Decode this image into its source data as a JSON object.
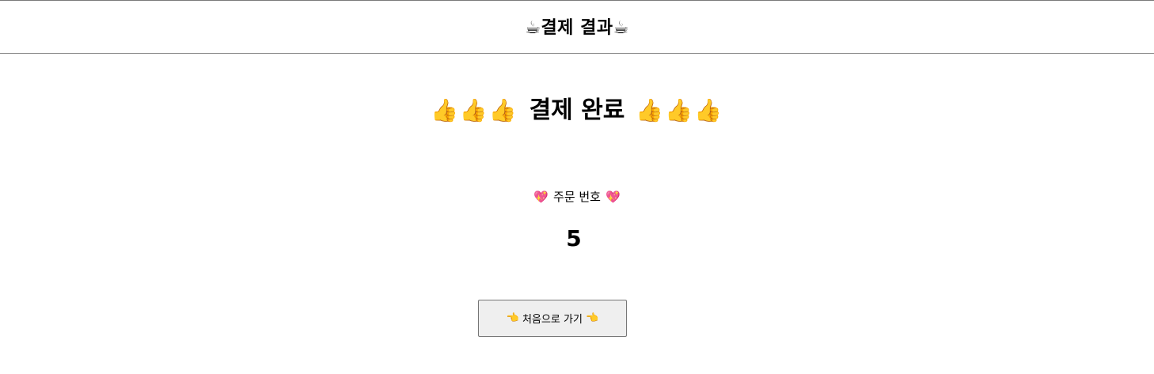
{
  "header": {
    "icon_left": "☕",
    "title": "결제 결과",
    "icon_right": "☕"
  },
  "complete": {
    "thumbs_left": "👍👍👍",
    "title": "결제 완료",
    "thumbs_right": "👍👍👍"
  },
  "order": {
    "heart_left": "💖",
    "label": "주문 번호",
    "heart_right": "💖",
    "number": "5"
  },
  "home_button": {
    "point_left": "👈",
    "label": "처음으로 가기",
    "point_right": "👈"
  }
}
